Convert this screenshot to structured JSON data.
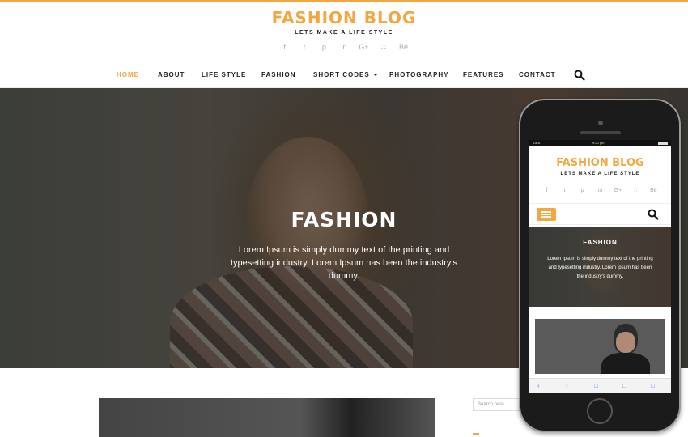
{
  "brand": {
    "title": "FASHION BLOG",
    "tagline": "LETS MAKE A LIFE STYLE"
  },
  "social_icons": [
    "facebook-icon",
    "twitter-icon",
    "pinterest-icon",
    "linkedin-icon",
    "google-plus-icon",
    "rss-icon",
    "behance-icon"
  ],
  "social_glyphs": [
    "f",
    "t",
    "p",
    "in",
    "G+",
    "∷",
    "Bé"
  ],
  "nav": {
    "items": [
      {
        "label": "HOME"
      },
      {
        "label": "ABOUT"
      },
      {
        "label": "LIFE STYLE"
      },
      {
        "label": "FASHION"
      },
      {
        "label": "SHORT CODES"
      },
      {
        "label": "PHOTOGRAPHY"
      },
      {
        "label": "FEATURES"
      },
      {
        "label": "CONTACT"
      }
    ]
  },
  "hero": {
    "title": "FASHION",
    "text": "Lorem Ipsum is simply dummy text of the printing and typesetting industry. Lorem Ipsum has been the industry's dummy."
  },
  "sidebar": {
    "search_placeholder": "Search here"
  },
  "phone": {
    "status": {
      "carrier": "IDEA",
      "time": "9:20 pm"
    },
    "title": "FASHION BLOG",
    "tagline": "LETS MAKE A LIFE STYLE",
    "hero_title": "FASHION",
    "hero_text": "Lorem Ipsum is simply dummy text of the printing and typesetting industry. Lorem Ipsum has been the industry's dummy."
  },
  "colors": {
    "accent": "#f4a640",
    "text": "#222222",
    "muted": "#aaaaaa"
  }
}
